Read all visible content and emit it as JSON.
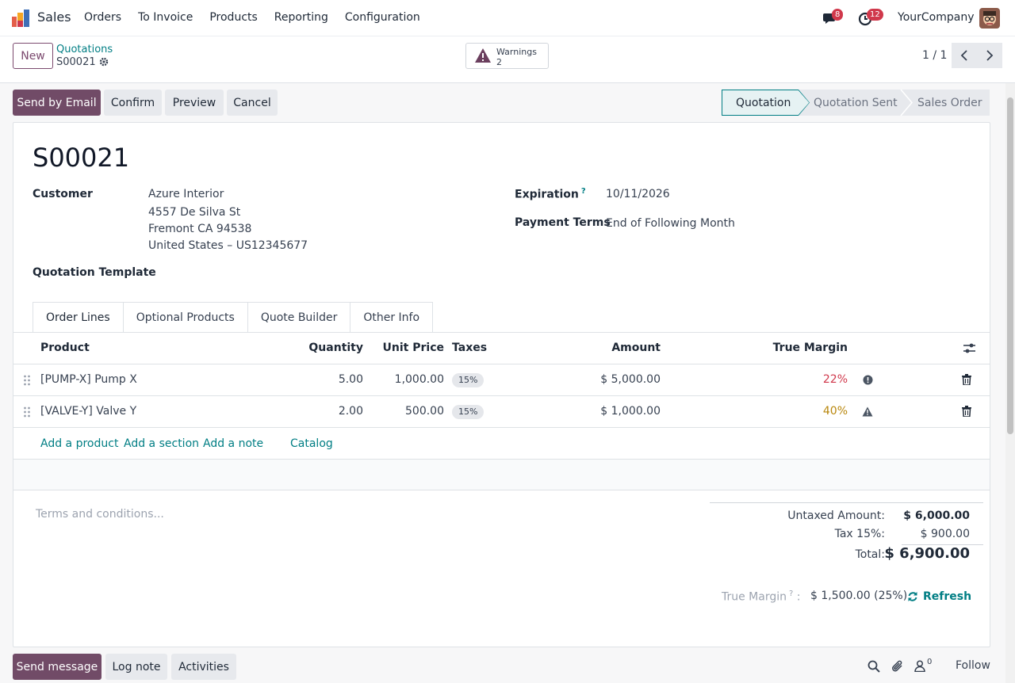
{
  "navbar": {
    "app_name": "Sales",
    "menu": [
      "Orders",
      "To Invoice",
      "Products",
      "Reporting",
      "Configuration"
    ],
    "messages_count": "8",
    "activities_count": "12",
    "company": "YourCompany"
  },
  "control": {
    "new_label": "New",
    "breadcrumb_parent": "Quotations",
    "breadcrumb_current": "S00021",
    "warnings_label": "Warnings",
    "warnings_count": "2",
    "pager": "1 / 1"
  },
  "actions": {
    "send_email": "Send by Email",
    "confirm": "Confirm",
    "preview": "Preview",
    "cancel": "Cancel"
  },
  "stages": [
    "Quotation",
    "Quotation Sent",
    "Sales Order"
  ],
  "form": {
    "title": "S00021",
    "customer_label": "Customer",
    "customer_name": "Azure Interior",
    "address1": "4557 De Silva St",
    "address2": "Fremont CA 94538",
    "address3": "United States – US12345677",
    "template_label": "Quotation Template",
    "expiration_label": "Expiration",
    "expiration_help": "?",
    "expiration_value": "10/11/2026",
    "payment_label": "Payment Terms",
    "payment_value": "End of Following Month"
  },
  "tabs": [
    "Order Lines",
    "Optional Products",
    "Quote Builder",
    "Other Info"
  ],
  "table": {
    "headers": {
      "product": "Product",
      "quantity": "Quantity",
      "unit_price": "Unit Price",
      "taxes": "Taxes",
      "amount": "Amount",
      "margin": "True Margin"
    },
    "rows": [
      {
        "product": "[PUMP-X] Pump X",
        "quantity": "5.00",
        "unit_price": "1,000.00",
        "tax": "15%",
        "amount": "$ 5,000.00",
        "margin": "22%"
      },
      {
        "product": "[VALVE-Y] Valve Y",
        "quantity": "2.00",
        "unit_price": "500.00",
        "tax": "15%",
        "amount": "$ 1,000.00",
        "margin": "40%"
      }
    ],
    "add_product": "Add a product",
    "add_section": "Add a section",
    "add_note": "Add a note",
    "catalog": "Catalog"
  },
  "footer": {
    "terms_placeholder": "Terms and conditions...",
    "untaxed_label": "Untaxed Amount:",
    "untaxed_value": "$ 6,000.00",
    "tax_label": "Tax 15%:",
    "tax_value": "$ 900.00",
    "total_label": "Total:",
    "total_value": "$ 6,900.00",
    "margin_label": "True Margin",
    "margin_help": "?",
    "margin_sep": ":",
    "margin_value": "$ 1,500.00 (25%)",
    "refresh": "Refresh"
  },
  "chatter": {
    "send_message": "Send message",
    "log_note": "Log note",
    "activities": "Activities",
    "followers_count": "0",
    "follow": "Follow"
  },
  "colors": {
    "primary": "#714b67",
    "link": "#017e84",
    "margin_low": "#d0384b",
    "margin_mid": "#b8860b"
  }
}
